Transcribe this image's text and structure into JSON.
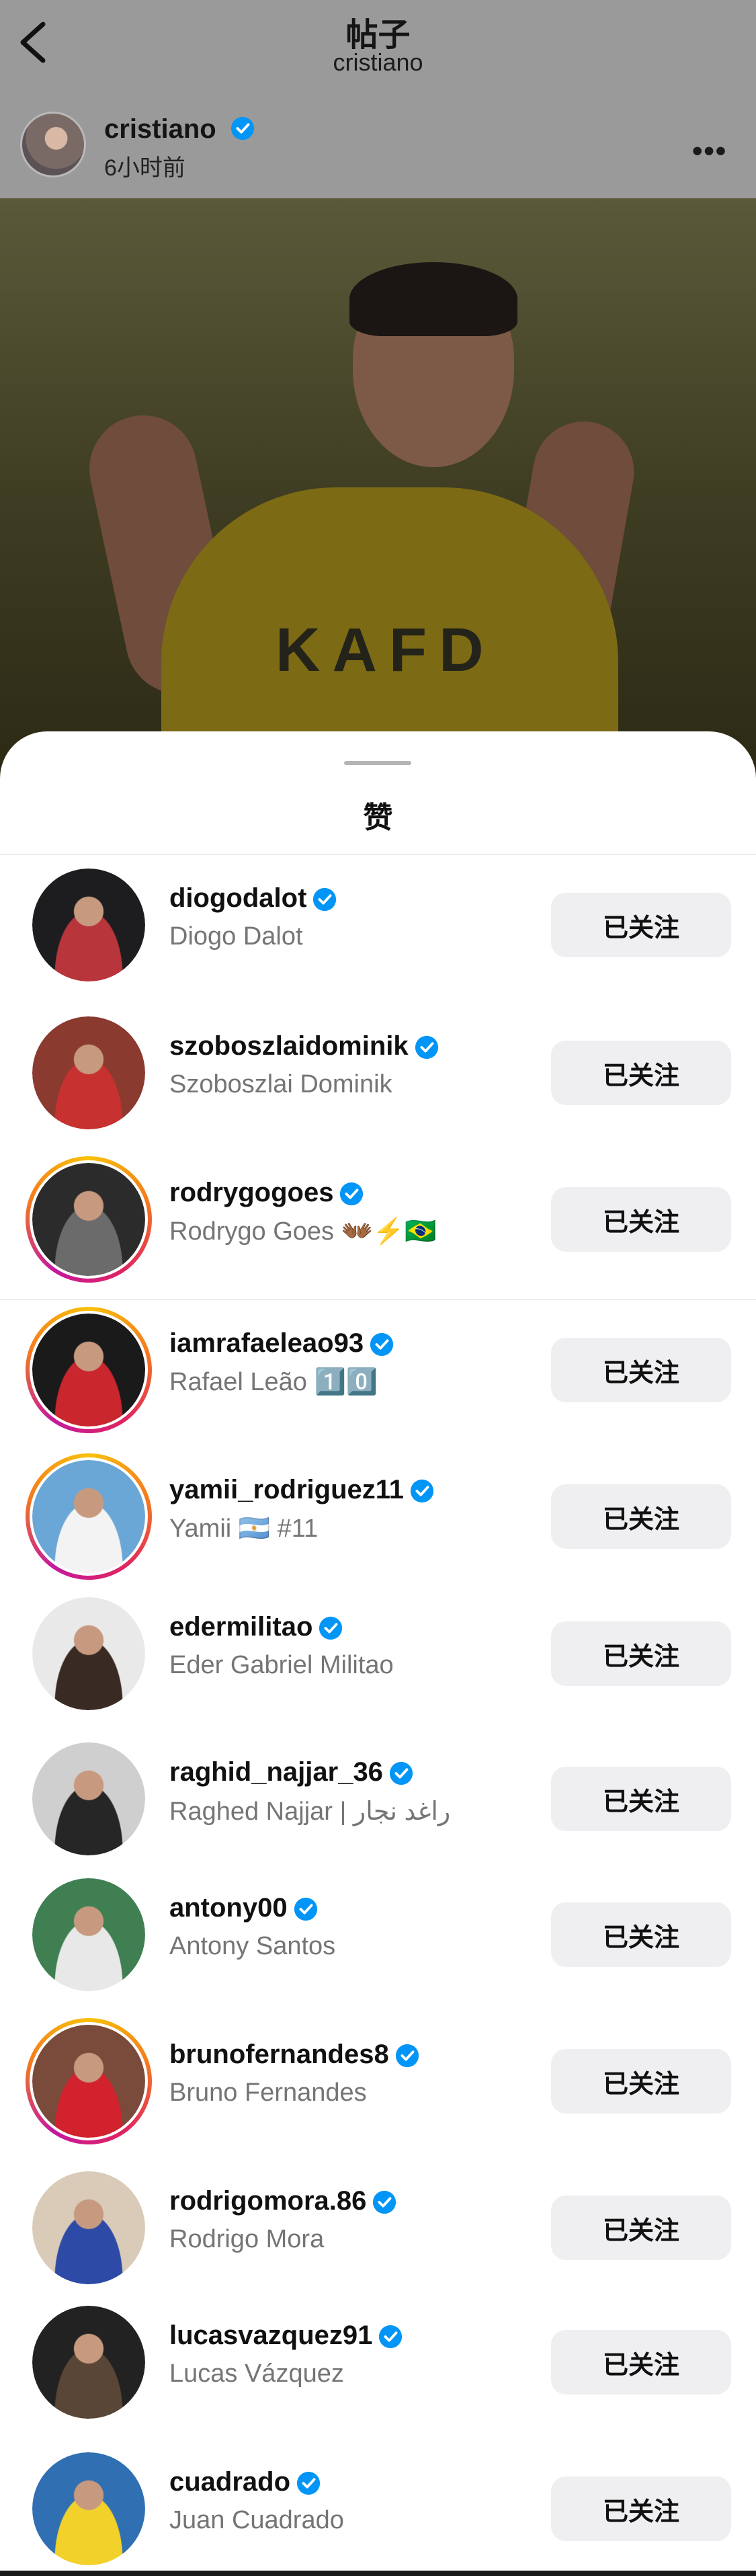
{
  "header": {
    "title": "帖子",
    "subtitle": "cristiano"
  },
  "post": {
    "author": "cristiano",
    "time": "6小时前",
    "shirt_text": "KAFD"
  },
  "sheet": {
    "title": "赞",
    "follow_label": "已关注"
  },
  "likers": [
    {
      "username": "diogodalot",
      "fullname": "Diogo Dalot",
      "story": false,
      "bg": "#1d1d1f",
      "fg": "#b8353b"
    },
    {
      "username": "szoboszlaidominik",
      "fullname": "Szoboszlai Dominik",
      "story": false,
      "bg": "#8a3a2f",
      "fg": "#c7312f"
    },
    {
      "username": "rodrygogoes",
      "fullname": "Rodrygo Goes 👐🏾⚡️🇧🇷",
      "story": true,
      "bg": "#2b2b2b",
      "fg": "#6b6b6b"
    },
    {
      "username": "iamrafaeleao93",
      "fullname": "Rafael Leão 1️⃣0️⃣",
      "story": true,
      "bg": "#1a1a1a",
      "fg": "#c9262d"
    },
    {
      "username": "yamii_rodriguez11",
      "fullname": "Yamii 🇦🇷 #11",
      "story": true,
      "bg": "#6aa6d6",
      "fg": "#f3f3f3"
    },
    {
      "username": "edermilitao",
      "fullname": "Eder Gabriel Militao",
      "story": false,
      "bg": "#e9e9e9",
      "fg": "#3a2a24"
    },
    {
      "username": "raghid_najjar_36",
      "fullname": "Raghed Najjar | راغد نجار",
      "story": false,
      "bg": "#cfcfcf",
      "fg": "#262626"
    },
    {
      "username": "antony00",
      "fullname": "Antony Santos",
      "story": false,
      "bg": "#3f7f52",
      "fg": "#e8e8e8"
    },
    {
      "username": "brunofernandes8",
      "fullname": "Bruno Fernandes",
      "story": true,
      "bg": "#7a4a3a",
      "fg": "#d1222d"
    },
    {
      "username": "rodrigomora.86",
      "fullname": "Rodrigo Mora",
      "story": false,
      "bg": "#d9cbb8",
      "fg": "#2c4aa6"
    },
    {
      "username": "lucasvazquez91",
      "fullname": "Lucas Vázquez",
      "story": false,
      "bg": "#222222",
      "fg": "#5a4636"
    },
    {
      "username": "cuadrado",
      "fullname": "Juan Cuadrado",
      "story": false,
      "bg": "#2f6fb2",
      "fg": "#f2d12b"
    }
  ]
}
